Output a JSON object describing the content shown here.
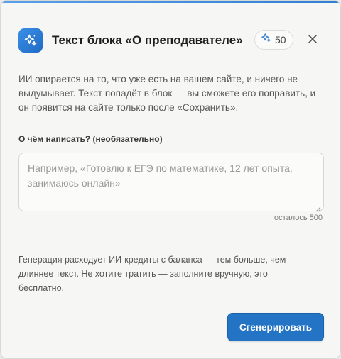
{
  "dialog": {
    "title": "Текст блока «О преподавателе»",
    "credits": {
      "count": "50",
      "icon": "sparkle-icon"
    },
    "close_icon": "close-icon",
    "intro": "ИИ опирается на то, что уже есть на вашем сайте, и ничего не выдумывает. Текст попадёт в блок — вы сможете его поправить, и он появится на сайте только после «Сохранить».",
    "prompt_field": {
      "label": "О чём написать? (необязательно)",
      "value": "",
      "placeholder": "Например, «Готовлю к ЕГЭ по математике, 12 лет опыта, занимаюсь онлайн»",
      "counter": "осталось 500"
    },
    "note": "Генерация расходует ИИ-кредиты с баланса — тем больше, чем длиннее текст. Не хотите тратить — заполните вручную, это бесплатно.",
    "generate_label": "Сгенерировать"
  },
  "colors": {
    "accent": "#2474c6",
    "icon_bg": "#2f80d8",
    "dialog_bg": "#f6f6f4",
    "text": "#1e1e1e",
    "muted": "#555555"
  }
}
